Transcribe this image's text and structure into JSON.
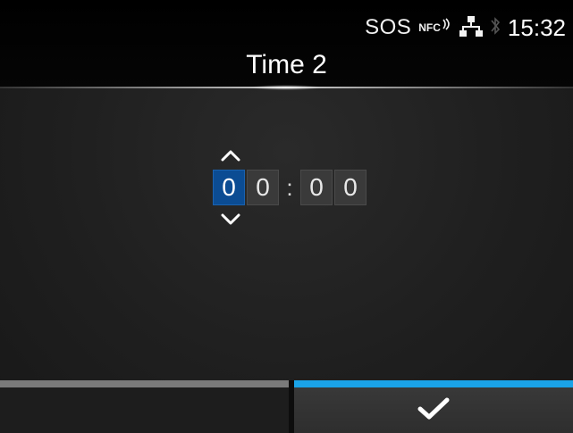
{
  "status": {
    "sos": "SOS",
    "nfc": "NFC",
    "time": "15:32",
    "icons": [
      "nfc-icon",
      "network-icon",
      "bluetooth-icon"
    ]
  },
  "title": "Time 2",
  "time_editor": {
    "digits": [
      "0",
      "0",
      "0",
      "0"
    ],
    "separator": ":",
    "selected_index": 0
  },
  "buttons": {
    "left": "",
    "right_icon": "check-icon"
  },
  "colors": {
    "accent": "#1aa3e8",
    "selected": "#0b4c93"
  }
}
